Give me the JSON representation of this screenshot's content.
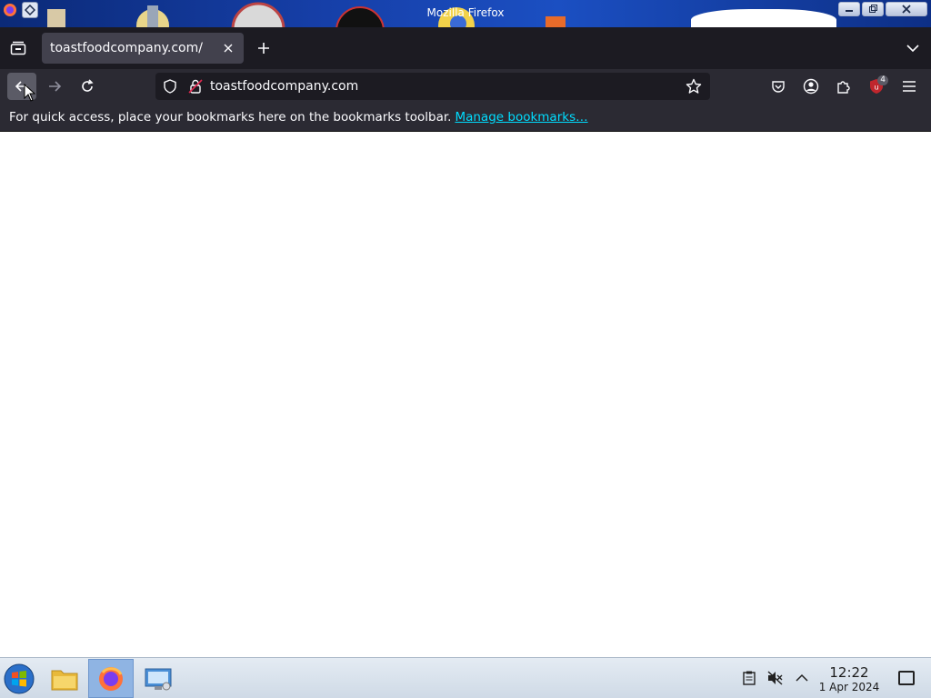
{
  "window": {
    "title": "Mozilla Firefox",
    "controls": [
      "minimize",
      "maximize",
      "close"
    ]
  },
  "tabs": [
    {
      "label": "toastfoodcompany.com/",
      "active": true
    }
  ],
  "toolbar": {
    "url": "toastfoodcompany.com",
    "extension_badge": "4"
  },
  "bookmarks_bar": {
    "message": "For quick access, place your bookmarks here on the bookmarks toolbar.",
    "link": "Manage bookmarks…"
  },
  "taskbar": {
    "time": "12:22",
    "date": "1 Apr 2024",
    "apps": [
      "start-orb",
      "file-manager",
      "firefox",
      "control-panel"
    ],
    "active_app": "firefox"
  },
  "colors": {
    "accent_link": "#00ddff",
    "tab_bg": "#42414d",
    "toolbar_bg": "#2b2a33",
    "tabstrip_bg": "#1c1b22",
    "extension_red": "#c0262d"
  }
}
